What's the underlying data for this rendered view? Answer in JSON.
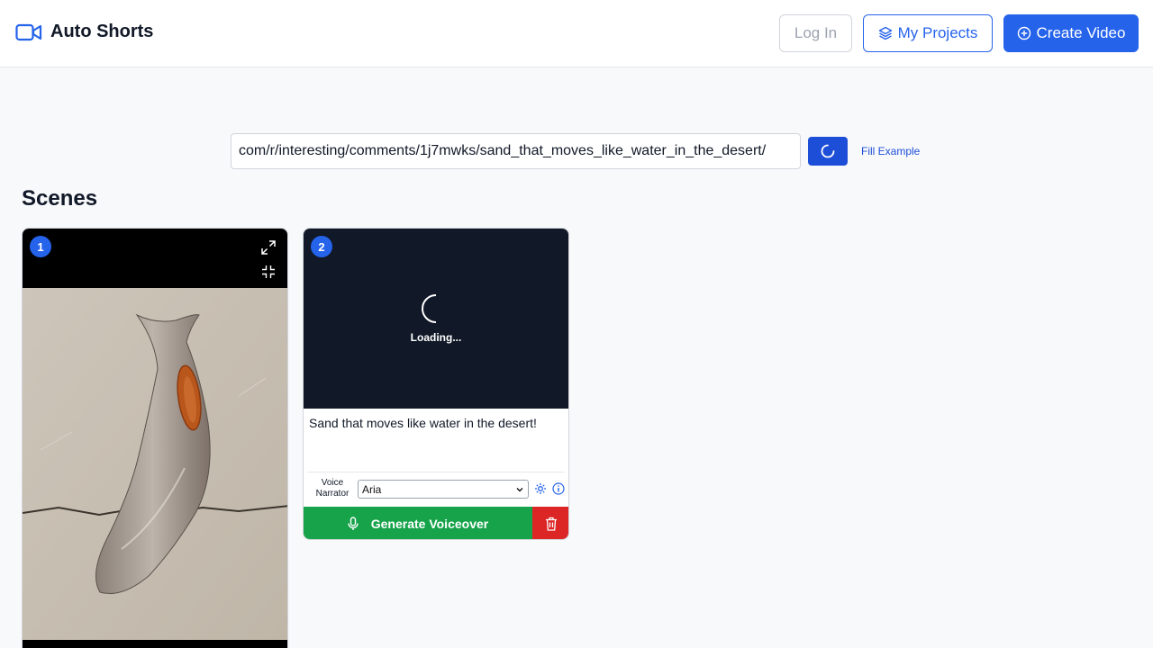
{
  "header": {
    "brand": "Auto Shorts",
    "login_label": "Log In",
    "projects_label": "My Projects",
    "create_label": "Create Video"
  },
  "url_bar": {
    "value": "com/r/interesting/comments/1j7mwks/sand_that_moves_like_water_in_the_desert/",
    "fill_example_label": "Fill Example"
  },
  "scenes": {
    "title": "Scenes",
    "items": [
      {
        "number": "1"
      },
      {
        "number": "2",
        "loading_text": "Loading...",
        "text": "Sand that moves like water in the desert!",
        "voice_label_line1": "Voice",
        "voice_label_line2": "Narrator",
        "voice_value": "Aria",
        "generate_label": "Generate Voiceover"
      }
    ]
  },
  "colors": {
    "primary": "#2563eb",
    "success": "#16a34a",
    "danger": "#dc2626",
    "video_bg": "#111827"
  }
}
